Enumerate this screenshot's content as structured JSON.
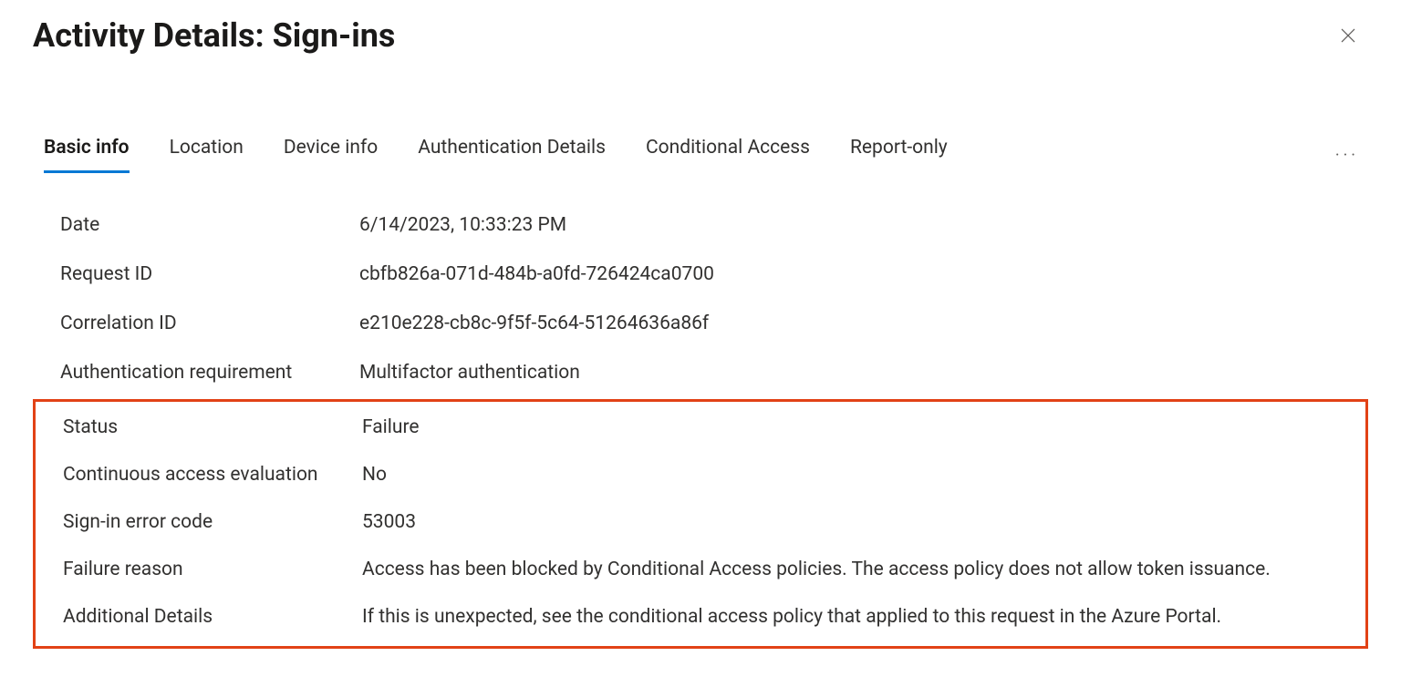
{
  "header": {
    "title": "Activity Details: Sign-ins"
  },
  "tabs": [
    {
      "label": "Basic info",
      "active": true
    },
    {
      "label": "Location",
      "active": false
    },
    {
      "label": "Device info",
      "active": false
    },
    {
      "label": "Authentication Details",
      "active": false
    },
    {
      "label": "Conditional Access",
      "active": false
    },
    {
      "label": "Report-only",
      "active": false
    }
  ],
  "fields": {
    "date": {
      "label": "Date",
      "value": "6/14/2023, 10:33:23 PM"
    },
    "request_id": {
      "label": "Request ID",
      "value": "cbfb826a-071d-484b-a0fd-726424ca0700"
    },
    "correlation_id": {
      "label": "Correlation ID",
      "value": "e210e228-cb8c-9f5f-5c64-51264636a86f"
    },
    "auth_requirement": {
      "label": "Authentication requirement",
      "value": "Multifactor authentication"
    },
    "status": {
      "label": "Status",
      "value": "Failure"
    },
    "cae": {
      "label": "Continuous access evaluation",
      "value": "No"
    },
    "error_code": {
      "label": "Sign-in error code",
      "value": "53003"
    },
    "failure_reason": {
      "label": "Failure reason",
      "value": "Access has been blocked by Conditional Access policies. The access policy does not allow token issuance."
    },
    "additional_details": {
      "label": "Additional Details",
      "value": "If this is unexpected, see the conditional access policy that applied to this request in the Azure Portal."
    }
  }
}
